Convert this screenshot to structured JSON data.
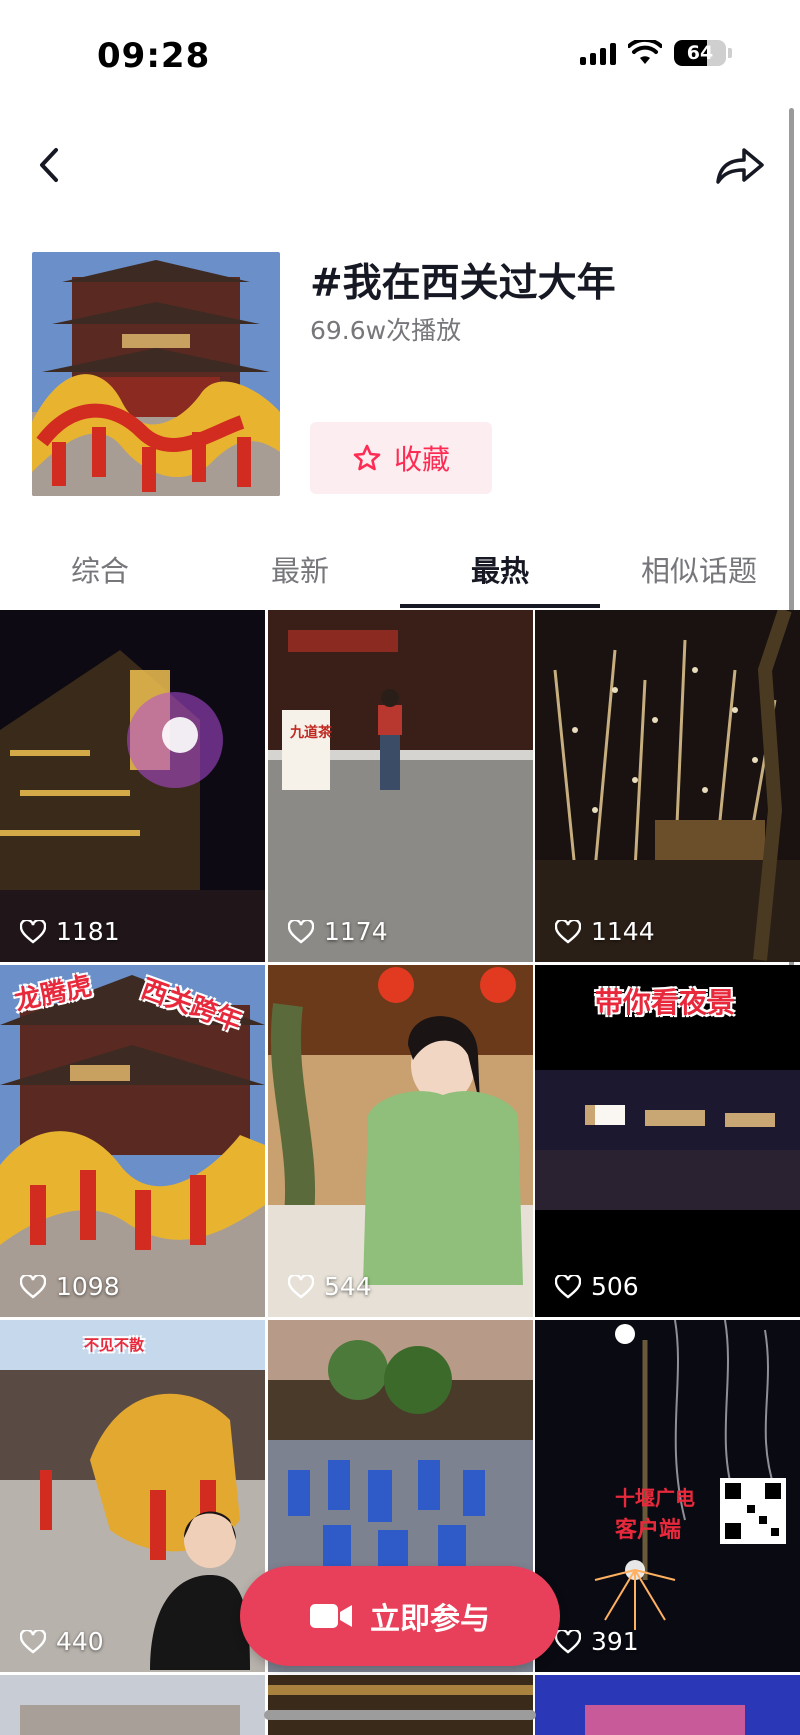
{
  "status_bar": {
    "time": "09:28",
    "battery": "64",
    "battery_level": 0.64
  },
  "nav": {
    "back_icon": "chevron-left-icon",
    "share_icon": "share-arrow-icon"
  },
  "topic": {
    "title": "#我在西关过大年",
    "plays": "69.6w次播放",
    "favorite_label": "收藏",
    "favorite_icon": "star-outline-icon"
  },
  "tabs": [
    {
      "label": "综合",
      "active": false
    },
    {
      "label": "最新",
      "active": false
    },
    {
      "label": "最热",
      "active": true
    },
    {
      "label": "相似话题",
      "active": false
    }
  ],
  "videos": [
    {
      "likes": "1181"
    },
    {
      "likes": "1174",
      "overlay": "九道茶"
    },
    {
      "likes": "1144"
    },
    {
      "likes": "1098",
      "overlay_left": "龙腾虎",
      "overlay_right": "西关跨年"
    },
    {
      "likes": "544"
    },
    {
      "likes": "506",
      "overlay": "带你看夜景"
    },
    {
      "likes": "440",
      "overlay": "不见不散"
    },
    {
      "likes": ""
    },
    {
      "likes": "391",
      "overlay": "十堰广电",
      "overlay_sub": "客户端"
    }
  ],
  "join_button": {
    "label": "立即参与",
    "icon": "video-camera-icon"
  },
  "colors": {
    "accent": "#fe2c55",
    "join": "#e8405a"
  }
}
